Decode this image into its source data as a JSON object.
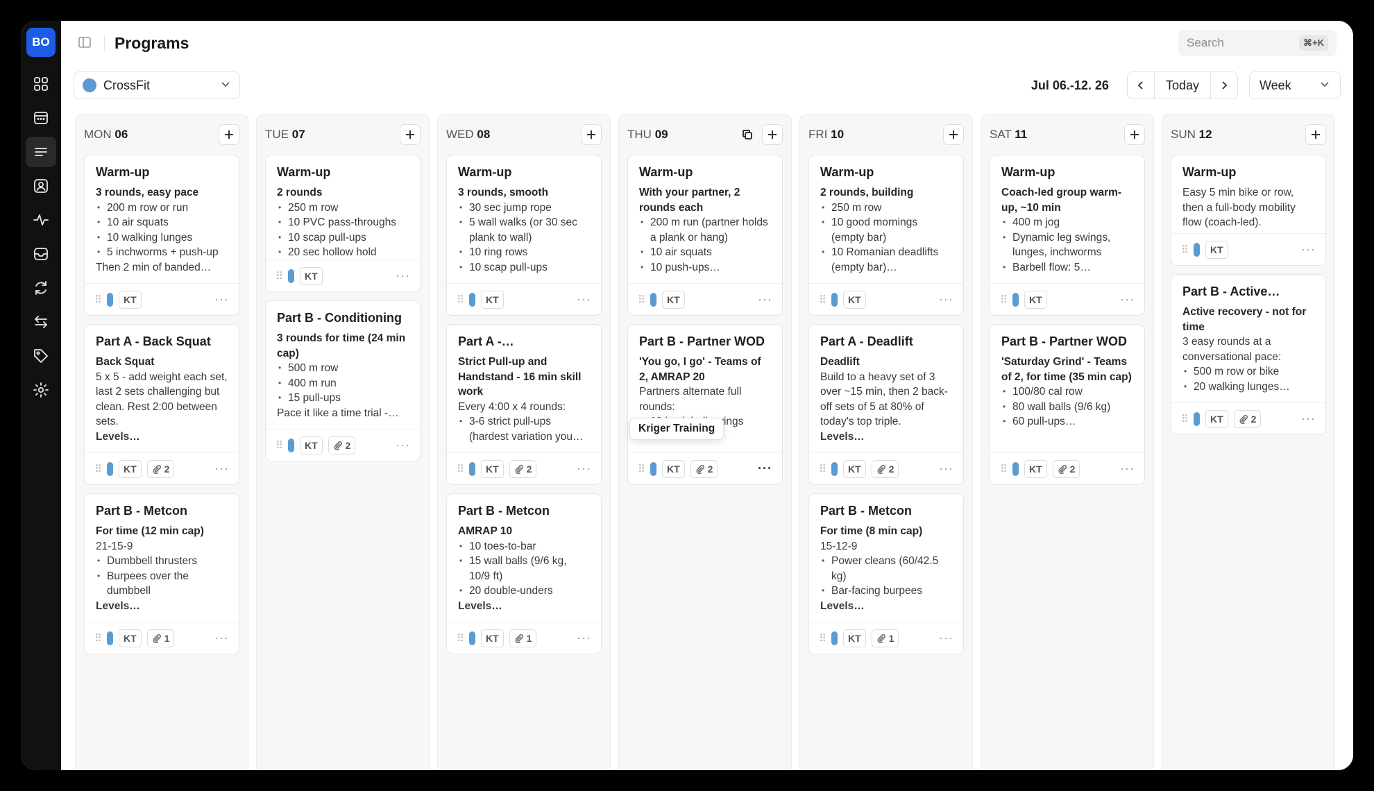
{
  "sidebar": {
    "org_badge": "BO",
    "items": [
      {
        "name": "nav-dashboard",
        "icon": "grid-icon"
      },
      {
        "name": "nav-calendar",
        "icon": "calendar-icon"
      },
      {
        "name": "nav-programs",
        "icon": "list-icon",
        "active": true
      },
      {
        "name": "nav-members",
        "icon": "user-card-icon"
      },
      {
        "name": "nav-activity",
        "icon": "pulse-icon"
      },
      {
        "name": "nav-inbox",
        "icon": "inbox-icon"
      },
      {
        "name": "nav-sync",
        "icon": "refresh-icon"
      },
      {
        "name": "nav-transfers",
        "icon": "arrows-icon"
      },
      {
        "name": "nav-tags",
        "icon": "tag-icon"
      },
      {
        "name": "nav-settings",
        "icon": "gear-icon"
      }
    ]
  },
  "header": {
    "title": "Programs",
    "search_placeholder": "Search",
    "search_shortcut": "⌘+K"
  },
  "controls": {
    "program": "CrossFit",
    "program_color": "#5a9bd1",
    "date_range": "Jul 06.-12. 26",
    "today_label": "Today",
    "view": "Week"
  },
  "tooltip": "Kriger Training",
  "days": [
    {
      "dow": "MON",
      "num": "06",
      "cards": [
        {
          "title": "Warm-up",
          "sub": "3 rounds, easy pace",
          "items": [
            "200 m row or run",
            "10 air squats",
            "10 walking lunges",
            "5 inchworms + push-up"
          ],
          "tail": "Then 2 min of banded…",
          "tag": "KT",
          "attachments": ""
        },
        {
          "title": "Part A - Back Squat",
          "sub": "Back Squat",
          "text": "5 x 5 - add weight each set, last 2 sets challenging but clean. Rest 2:00 between sets.",
          "end": "Levels…",
          "tag": "KT",
          "attachments": "2"
        },
        {
          "title": "Part B - Metcon",
          "sub": "For time (12 min cap)",
          "text": "21-15-9",
          "items": [
            "Dumbbell thrusters",
            "Burpees over the dumbbell"
          ],
          "end": "Levels…",
          "tag": "KT",
          "attachments": "1"
        }
      ]
    },
    {
      "dow": "TUE",
      "num": "07",
      "cards": [
        {
          "title": "Warm-up",
          "sub": "2 rounds",
          "items": [
            "250 m row",
            "10 PVC pass-throughs",
            "10 scap pull-ups",
            "20 sec hollow hold"
          ],
          "tag": "KT",
          "attachments": "",
          "compact": true
        },
        {
          "title": "Part B - Conditioning",
          "sub": "3 rounds for time (24 min cap)",
          "items": [
            "500 m row",
            "400 m run",
            "15 pull-ups"
          ],
          "tail": "Pace it like a time trial -…",
          "tag": "KT",
          "attachments": "2"
        }
      ]
    },
    {
      "dow": "WED",
      "num": "08",
      "cards": [
        {
          "title": "Warm-up",
          "sub": "3 rounds, smooth",
          "items": [
            "30 sec jump rope",
            "5 wall walks (or 30 sec plank to wall)",
            "10 ring rows",
            "10 scap pull-ups"
          ],
          "tag": "KT",
          "attachments": ""
        },
        {
          "title": "Part A -…",
          "sub": "Strict Pull-up and Handstand - 16 min skill work",
          "text": "Every 4:00 x 4 rounds:",
          "items": [
            "3-6 strict pull-ups (hardest variation you…"
          ],
          "tag": "KT",
          "attachments": "2"
        },
        {
          "title": "Part B - Metcon",
          "sub": "AMRAP 10",
          "items": [
            "10 toes-to-bar",
            "15 wall balls (9/6 kg, 10/9 ft)",
            "20 double-unders"
          ],
          "end": "Levels…",
          "tag": "KT",
          "attachments": "1"
        }
      ]
    },
    {
      "dow": "THU",
      "num": "09",
      "copy": true,
      "cards": [
        {
          "title": "Warm-up",
          "sub": "With your partner, 2 rounds each",
          "items": [
            "200 m run (partner holds a plank or hang)",
            "10 air squats",
            "10 push-ups…"
          ],
          "tag": "KT",
          "attachments": ""
        },
        {
          "title": "Part B - Partner WOD",
          "sub": "'You go, I go' - Teams of 2, AMRAP 20",
          "text": "Partners alternate full rounds:",
          "items": [
            "12 kettlebell swings"
          ],
          "tag": "KT",
          "attachments": "2",
          "hover": true
        }
      ]
    },
    {
      "dow": "FRI",
      "num": "10",
      "cards": [
        {
          "title": "Warm-up",
          "sub": "2 rounds, building",
          "items": [
            "250 m row",
            "10 good mornings (empty bar)",
            "10 Romanian deadlifts (empty bar)…"
          ],
          "tag": "KT",
          "attachments": ""
        },
        {
          "title": "Part A - Deadlift",
          "sub": "Deadlift",
          "text": "Build to a heavy set of 3 over ~15 min, then 2 back-off sets of 5 at 80% of today's top triple.",
          "end": "Levels…",
          "tag": "KT",
          "attachments": "2"
        },
        {
          "title": "Part B - Metcon",
          "sub": "For time (8 min cap)",
          "text": "15-12-9",
          "items": [
            "Power cleans (60/42.5 kg)",
            "Bar-facing burpees"
          ],
          "end": "Levels…",
          "tag": "KT",
          "attachments": "1"
        }
      ]
    },
    {
      "dow": "SAT",
      "num": "11",
      "cards": [
        {
          "title": "Warm-up",
          "sub": "Coach-led group warm-up, ~10 min",
          "items": [
            "400 m jog",
            "Dynamic leg swings, lunges, inchworms",
            "Barbell flow: 5…"
          ],
          "tag": "KT",
          "attachments": ""
        },
        {
          "title": "Part B - Partner WOD",
          "sub": "'Saturday Grind' - Teams of 2, for time (35 min cap)",
          "items": [
            "100/80 cal row",
            "80 wall balls (9/6 kg)",
            "60 pull-ups…"
          ],
          "tag": "KT",
          "attachments": "2"
        }
      ]
    },
    {
      "dow": "SUN",
      "num": "12",
      "cards": [
        {
          "title": "Warm-up",
          "text": "Easy 5 min bike or row, then a full-body mobility flow (coach-led).",
          "tag": "KT",
          "attachments": "",
          "short": true
        },
        {
          "title": "Part B - Active…",
          "sub": "Active recovery - not for time",
          "text": "3 easy rounds at a conversational pace:",
          "items": [
            "500 m row or bike",
            "20 walking lunges…"
          ],
          "tag": "KT",
          "attachments": "2"
        }
      ]
    }
  ]
}
